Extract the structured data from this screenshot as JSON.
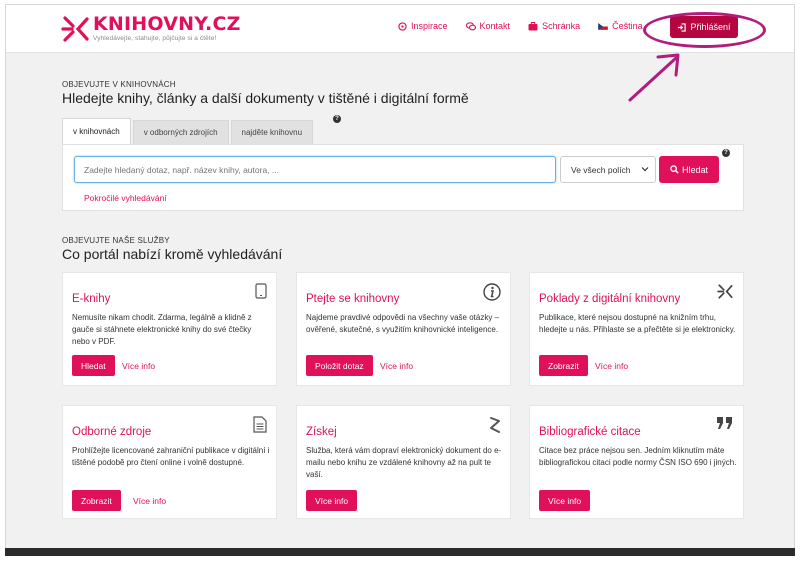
{
  "brand": {
    "name": "KNIHOVNY.CZ",
    "tagline": "Vyhledávejte, stahujte, půjčujte si a čtěte!",
    "accent": "#e0105a"
  },
  "nav": {
    "items": [
      {
        "label": "Inspirace",
        "icon": "lightbulb-icon"
      },
      {
        "label": "Kontakt",
        "icon": "chat-icon"
      },
      {
        "label": "Schránka",
        "icon": "briefcase-icon"
      },
      {
        "label": "Čeština",
        "icon": "czech-flag-icon"
      }
    ],
    "login_label": "Přihlášení"
  },
  "search": {
    "kicker": "OBJEVUJTE V KNIHOVNÁCH",
    "title": "Hledejte knihy, články a další dokumenty v tištěné i digitální formě",
    "tabs": [
      "v knihovnách",
      "v odborných zdrojích",
      "najděte knihovnu"
    ],
    "placeholder": "Zadejte hledaný dotaz, např. název knihy, autora, ...",
    "scope": "Ve všech polích",
    "button": "Hledat",
    "advanced": "Pokročilé vyhledávání"
  },
  "services": {
    "kicker": "OBJEVUJTE NAŠE SLUŽBY",
    "title": "Co portál nabízí kromě vyhledávání",
    "cards": [
      {
        "title": "E-knihy",
        "text": "Nemusíte nikam chodit. Zdarma, legálně a klidně z gauče si stáhnete elektronické knihy do své čtečky nebo v PDF.",
        "button": "Hledat",
        "link": "Více info",
        "icon": "tablet-icon"
      },
      {
        "title": "Ptejte se knihovny",
        "text": "Najdeme pravdivé odpovědi na všechny vaše otázky – ověřené, skutečné, s využitím knihovnické inteligence.",
        "button": "Položit dotaz",
        "link": "Více info",
        "icon": "info-icon"
      },
      {
        "title": "Poklady z digitální knihovny",
        "text": "Publikace, které nejsou dostupné na knižním trhu, hledejte u nás. Přihlaste se a přečtěte si je elektronicky.",
        "button": "Zobrazit",
        "link": "Více info",
        "icon": "knihovny-logo-icon"
      },
      {
        "title": "Odborné zdroje",
        "text": "Prohlížejte licencované zahraniční publikace v digitální i tištěné podobě pro čtení online i volně dostupné.",
        "button": "Zobrazit",
        "link": "Více info",
        "icon": "document-icon"
      },
      {
        "title": "Získej",
        "text": "Služba, která vám dopraví elektronický dokument do e-mailu nebo knihu ze vzdálené knihovny až na pult te vaší.",
        "button": "Více info",
        "link": "",
        "icon": "ziskej-logo-icon"
      },
      {
        "title": "Bibliografické citace",
        "text": "Citace bez práce nejsou sen. Jedním kliknutím máte bibliografickou citaci podle normy ČSN ISO 690 i jiných.",
        "button": "Více info",
        "link": "",
        "icon": "quote-icon"
      }
    ]
  }
}
